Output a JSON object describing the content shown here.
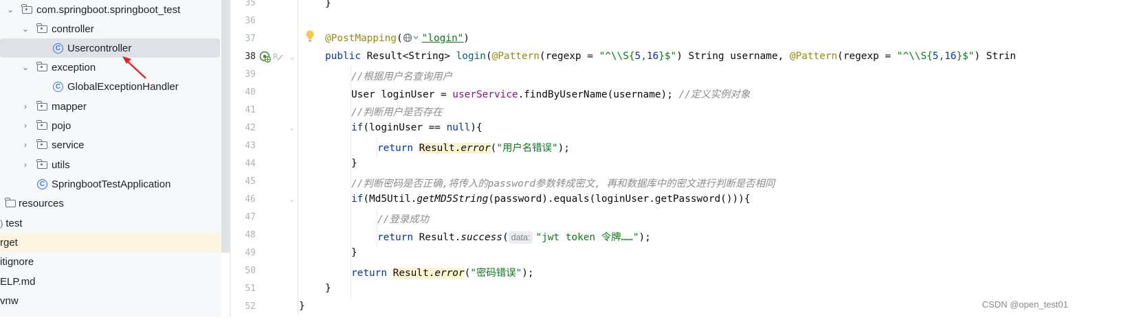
{
  "project_tree": {
    "items": [
      {
        "label": "com.springboot.springboot_test",
        "type": "package",
        "expanded": true
      },
      {
        "label": "controller",
        "type": "package",
        "expanded": true
      },
      {
        "label": "Usercontroller",
        "type": "class",
        "selected": true
      },
      {
        "label": "exception",
        "type": "package",
        "expanded": true
      },
      {
        "label": "GlobalExceptionHandler",
        "type": "class"
      },
      {
        "label": "mapper",
        "type": "package",
        "expanded": false
      },
      {
        "label": "pojo",
        "type": "package",
        "expanded": false
      },
      {
        "label": "service",
        "type": "package",
        "expanded": false
      },
      {
        "label": "utils",
        "type": "package",
        "expanded": false
      },
      {
        "label": "SpringbootTestApplication",
        "type": "app-class"
      },
      {
        "label": "resources",
        "type": "resources-folder"
      },
      {
        "label": "test",
        "type": "folder"
      },
      {
        "label": "rget",
        "type": "folder",
        "highlighted": true
      },
      {
        "label": "itignore",
        "type": "file"
      },
      {
        "label": "ELP.md",
        "type": "file"
      },
      {
        "label": "vnw",
        "type": "file"
      }
    ]
  },
  "editor": {
    "line_numbers": [
      "35",
      "36",
      "37",
      "38",
      "39",
      "40",
      "41",
      "42",
      "43",
      "44",
      "45",
      "46",
      "47",
      "48",
      "49",
      "50",
      "51",
      "52"
    ],
    "current_line": "38",
    "code": {
      "l35": "}",
      "l37_annotation": "@PostMapping",
      "l37_paren_open": "(",
      "l37_string": "\"login\"",
      "l37_paren_close": ")",
      "l38_public": "public",
      "l38_sig": " Result<String> ",
      "l38_method": "login",
      "l38_paren": "(",
      "l38_ann1": "@Pattern",
      "l38_regexp1": "(regexp = ",
      "l38_str1_a": "\"^\\\\S{",
      "l38_num1a": "5",
      "l38_comma1": ",",
      "l38_num1b": "16",
      "l38_str1_b": "}$\"",
      "l38_after1": ") String username, ",
      "l38_ann2": "@Pattern",
      "l38_regexp2": "(regexp = ",
      "l38_str2_a": "\"^\\\\S{",
      "l38_num2a": "5",
      "l38_comma2": ",",
      "l38_num2b": "16",
      "l38_str2_b": "}$\"",
      "l38_after2": ") Strin",
      "l39_comment": "//根据用户名查询用户",
      "l40_a": "User loginUser = ",
      "l40_field": "userService",
      "l40_b": ".findByUserName(username); ",
      "l40_comment": "//定义实例对象",
      "l41_comment": "//判断用户是否存在",
      "l42_if": "if",
      "l42_a": "(loginUser == ",
      "l42_null": "null",
      "l42_b": "){",
      "l43_return": "return",
      "l43_result": "Result.",
      "l43_error": "error",
      "l43_a": "(",
      "l43_str": "\"用户名错误\"",
      "l43_b": ");",
      "l44": "}",
      "l45_comment": "//判断密码是否正确,将传入的password参数转成密文, 再和数据库中的密文进行判断是否相同",
      "l46_if": "if",
      "l46_a": "(Md5Util.",
      "l46_method": "getMD5String",
      "l46_b": "(password).equals(loginUser.getPassword())){",
      "l47_comment": "//登录成功",
      "l48_return": "return",
      "l48_a": " Result.",
      "l48_success": "success",
      "l48_paren": "(",
      "l48_hint": "data:",
      "l48_str": "\"jwt token 令牌……\"",
      "l48_b": ");",
      "l49": "}",
      "l50_return": "return",
      "l50_result": "Result.",
      "l50_error": "error",
      "l50_a": "(",
      "l50_str": "\"密码错误\"",
      "l50_b": ");",
      "l51": "}",
      "l52": "}"
    }
  },
  "icons": {
    "bulb": "lightbulb-icon",
    "run": "run-gutter-icon",
    "endpoint": "web-endpoint-icon",
    "arrow": "red-arrow-annotation"
  },
  "colors": {
    "arrow": "#e0252b",
    "keyword": "#0033b3",
    "string": "#067d17",
    "annotation": "#9e880d",
    "comment": "#8c8c8c"
  },
  "watermark": "CSDN @open_test01"
}
